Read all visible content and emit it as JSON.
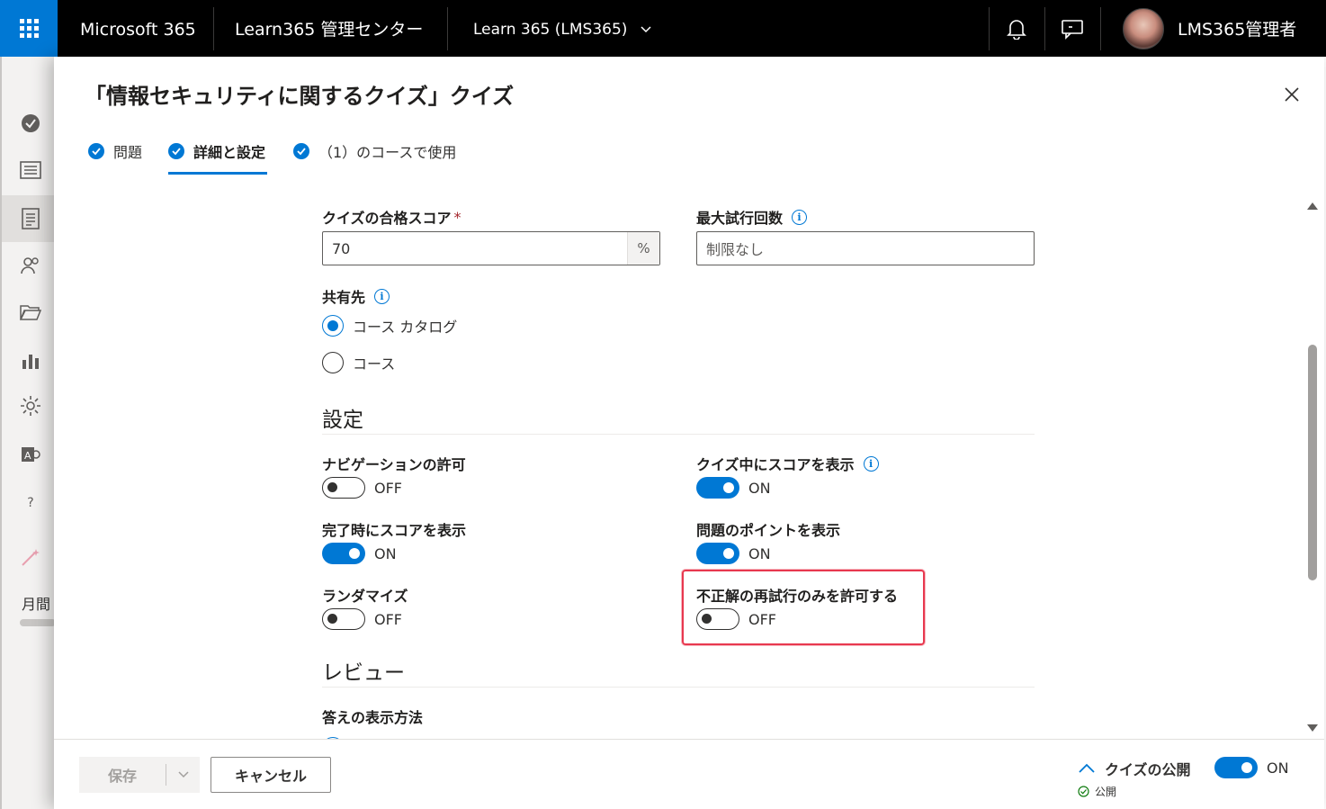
{
  "topbar": {
    "app_name": "Microsoft 365",
    "admin_center": "Learn365 管理センター",
    "tenant": "Learn 365 (LMS365)",
    "user_name": "LMS365管理者",
    "brand_color": "#0078d4"
  },
  "leftnav": {
    "icons": [
      "check-circle-icon",
      "list-icon",
      "document-icon",
      "people-icon",
      "folder-icon",
      "bar-chart-icon",
      "gear-icon",
      "exchange-icon",
      "help-icon",
      "wand-icon"
    ],
    "help_glyph": "?",
    "partial_text": "月間"
  },
  "panel": {
    "title": "「情報セキュリティに関するクイズ」クイズ",
    "steps": [
      {
        "label": "問題"
      },
      {
        "label": "詳細と設定"
      },
      {
        "label": "（1）のコースで使用"
      }
    ],
    "passing_score": {
      "label": "クイズの合格スコア",
      "required_mark": "*",
      "value": "70",
      "suffix": "%"
    },
    "max_attempts": {
      "label": "最大試行回数",
      "placeholder": "制限なし"
    },
    "share": {
      "label": "共有先",
      "options": [
        "コース カタログ",
        "コース"
      ],
      "selected": "コース カタログ"
    },
    "settings_heading": "設定",
    "settings": {
      "navigation": {
        "label": "ナビゲーションの許可",
        "state": "OFF"
      },
      "show_score_during": {
        "label": "クイズ中にスコアを表示",
        "state": "ON"
      },
      "show_score_completion": {
        "label": "完了時にスコアを表示",
        "state": "ON"
      },
      "show_points": {
        "label": "問題のポイントを表示",
        "state": "ON"
      },
      "randomize": {
        "label": "ランダマイズ",
        "state": "OFF"
      },
      "retry_incorrect": {
        "label": "不正解の再試行のみを許可する",
        "state": "OFF"
      }
    },
    "review_heading": "レビュー",
    "answer_display_label": "答えの表示方法",
    "info_glyph": "i"
  },
  "footer": {
    "save_label": "保存",
    "cancel_label": "キャンセル",
    "publish_label": "クイズの公開",
    "publish_status": "公開",
    "publish_state": "ON"
  }
}
